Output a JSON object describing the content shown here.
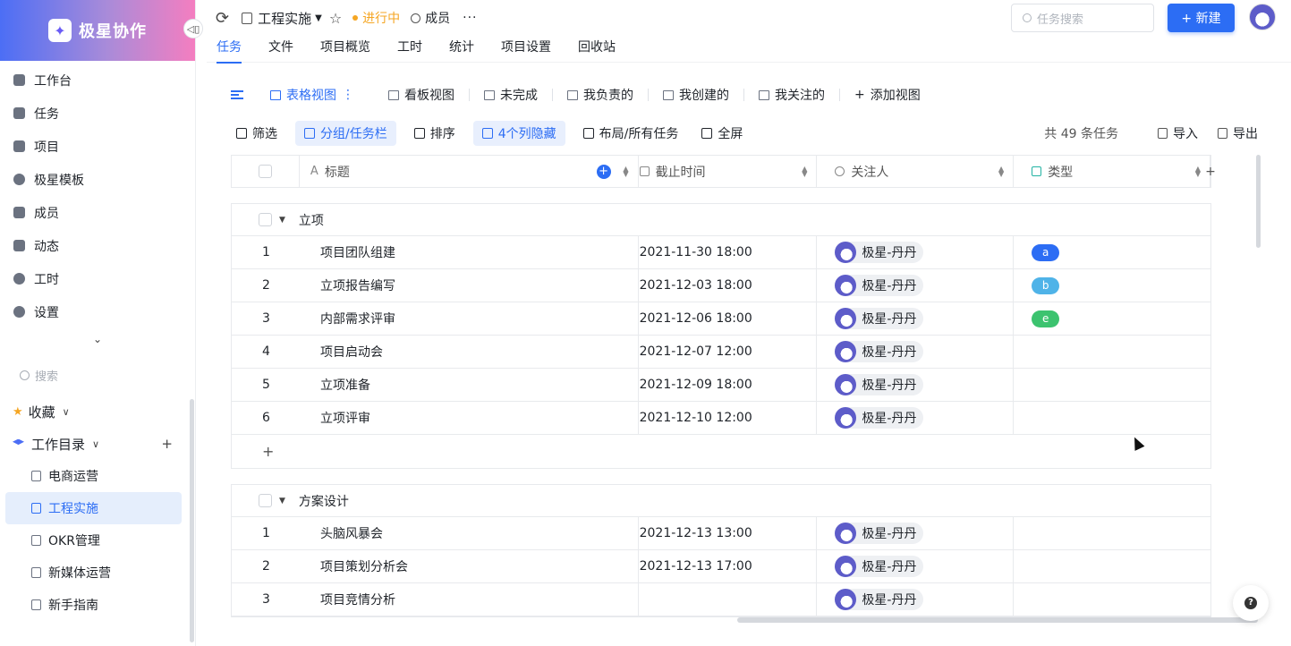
{
  "app": {
    "brand": "极星协作"
  },
  "sidebar": {
    "nav": [
      {
        "label": "工作台",
        "icon": "dashboard-icon"
      },
      {
        "label": "任务",
        "icon": "task-icon"
      },
      {
        "label": "项目",
        "icon": "layers-icon"
      },
      {
        "label": "极星模板",
        "icon": "template-icon"
      },
      {
        "label": "成员",
        "icon": "members-icon"
      },
      {
        "label": "动态",
        "icon": "activity-icon"
      },
      {
        "label": "工时",
        "icon": "pie-icon"
      },
      {
        "label": "设置",
        "icon": "settings-icon"
      }
    ],
    "search_placeholder": "搜索",
    "favorites_label": "收藏",
    "workdir_label": "工作目录",
    "docs": [
      "电商运营",
      "工程实施",
      "OKR管理",
      "新媒体运营",
      "新手指南"
    ],
    "active_doc": "工程实施"
  },
  "header": {
    "project_title": "工程实施",
    "status": "进行中",
    "members": "成员",
    "search_placeholder": "任务搜索",
    "new_button": "+ 新建",
    "colors": {
      "accent": "#2c6df4",
      "status": "#f5a623"
    }
  },
  "tabs": [
    "任务",
    "文件",
    "项目概览",
    "工时",
    "统计",
    "项目设置",
    "回收站"
  ],
  "views": [
    "表格视图",
    "看板视图",
    "未完成",
    "我负责的",
    "我创建的",
    "我关注的",
    "添加视图"
  ],
  "toolbar": {
    "filter": "筛选",
    "group": "分组/任务栏",
    "sort": "排序",
    "hidden": "4个列隐藏",
    "layout": "布局/所有任务",
    "fullscreen": "全屏",
    "count": "共 49 条任务",
    "import": "导入",
    "export": "导出"
  },
  "columns": {
    "title": "标题",
    "due": "截止时间",
    "watchers": "关注人",
    "type": "类型"
  },
  "groups": [
    {
      "name": "立项",
      "rows": [
        {
          "no": "1",
          "title": "项目团队组建",
          "due": "2021-11-30 18:00",
          "watcher": "极星-丹丹",
          "type": "a",
          "type_color": "#2c6df4"
        },
        {
          "no": "2",
          "title": "立项报告编写",
          "due": "2021-12-03 18:00",
          "watcher": "极星-丹丹",
          "type": "b",
          "type_color": "#4fb3e8"
        },
        {
          "no": "3",
          "title": "内部需求评审",
          "due": "2021-12-06 18:00",
          "watcher": "极星-丹丹",
          "type": "e",
          "type_color": "#3cc36f"
        },
        {
          "no": "4",
          "title": "项目启动会",
          "due": "2021-12-07 12:00",
          "watcher": "极星-丹丹",
          "type": "",
          "type_color": ""
        },
        {
          "no": "5",
          "title": "立项准备",
          "due": "2021-12-09 18:00",
          "watcher": "极星-丹丹",
          "type": "",
          "type_color": ""
        },
        {
          "no": "6",
          "title": "立项评审",
          "due": "2021-12-10 12:00",
          "watcher": "极星-丹丹",
          "type": "",
          "type_color": ""
        }
      ]
    },
    {
      "name": "方案设计",
      "rows": [
        {
          "no": "1",
          "title": "头脑风暴会",
          "due": "2021-12-13 13:00",
          "watcher": "极星-丹丹",
          "type": "",
          "type_color": ""
        },
        {
          "no": "2",
          "title": "项目策划分析会",
          "due": "2021-12-13 17:00",
          "watcher": "极星-丹丹",
          "type": "",
          "type_color": ""
        },
        {
          "no": "3",
          "title": "项目竞情分析",
          "due": "",
          "watcher": "极星-丹丹",
          "type": "",
          "type_color": ""
        }
      ]
    }
  ]
}
